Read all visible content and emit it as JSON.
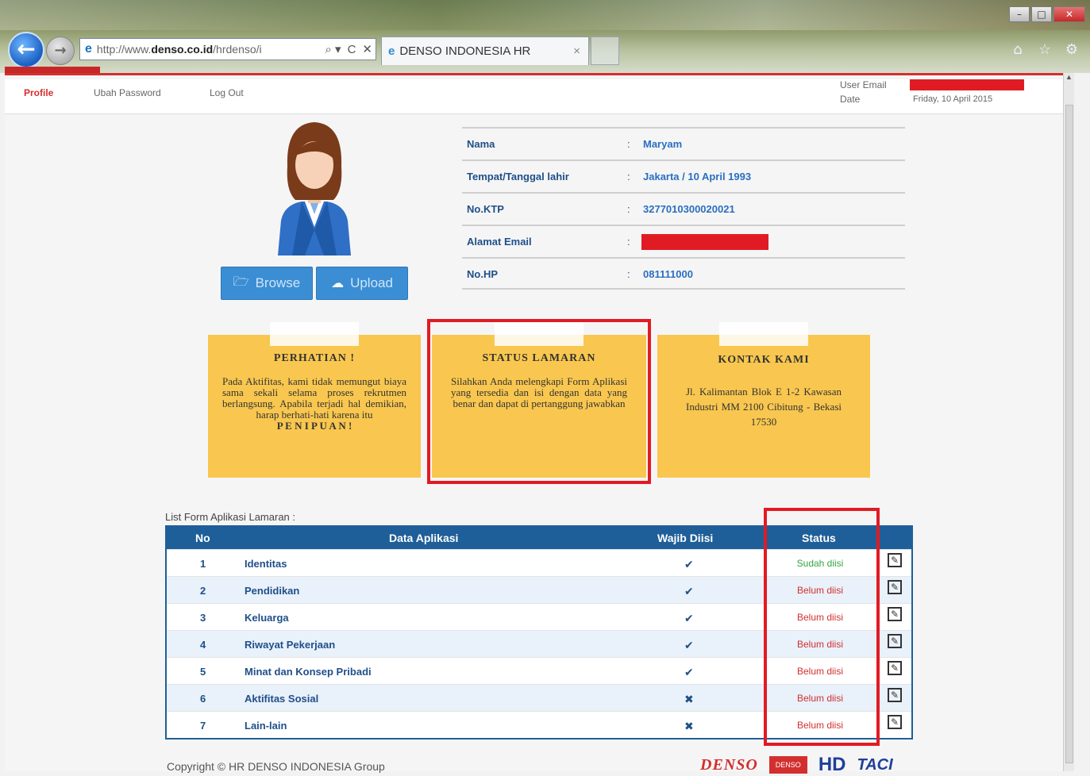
{
  "browser": {
    "url": "http://www.denso.co.id/hrdenso/i",
    "url_parts": {
      "prefix": "http://www.",
      "host": "denso.co.id",
      "path": "/hrdenso/i"
    },
    "tab_title": "DENSO INDONESIA HR",
    "tab_close": "×",
    "address_controls": [
      "⌕ ▾",
      "C",
      "✕"
    ],
    "window_buttons": {
      "minimize": "–",
      "maximize": "□",
      "close": "✕"
    },
    "tool_icons": [
      "home-icon",
      "star-icon",
      "gear-icon"
    ]
  },
  "topnav": {
    "items": [
      "Profile",
      "Ubah Password",
      "Log Out"
    ],
    "user_email_label": "User Email",
    "date_label": "Date",
    "date_value": "Friday, 10 April 2015"
  },
  "profile": {
    "fields": [
      {
        "label": "Nama",
        "value": "Maryam"
      },
      {
        "label": "Tempat/Tanggal lahir",
        "value": "Jakarta / 10 April 1993"
      },
      {
        "label": "No.KTP",
        "value": "3277010300020021"
      },
      {
        "label": "Alamat Email",
        "value": ""
      },
      {
        "label": "No.HP",
        "value": "081111000"
      }
    ],
    "colon": ":",
    "browse_label": "Browse",
    "upload_label": "Upload"
  },
  "notes": {
    "perhatian": {
      "title": "PERHATIAN !",
      "body": "Pada Aktifitas, kami tidak memungut biaya sama sekali selama proses rekrutmen berlangsung. Apabila terjadi hal demikian, harap berhati-hati karena itu",
      "emphasis": "P E N I P U A N !"
    },
    "status": {
      "title": "STATUS LAMARAN",
      "body": "Silahkan Anda melengkapi Form Aplikasi yang tersedia dan isi dengan data yang benar dan dapat di pertanggung jawabkan"
    },
    "kontak": {
      "title": "KONTAK KAMI",
      "body": "Jl. Kalimantan Blok E 1-2 Kawasan Industri MM 2100 Cibitung - Bekasi 17530"
    }
  },
  "list": {
    "title": "List Form Aplikasi Lamaran :",
    "headers": [
      "No",
      "Data Aplikasi",
      "Wajib Diisi",
      "Status"
    ],
    "rows": [
      {
        "no": "1",
        "name": "Identitas",
        "wajib": "✔",
        "status": "Sudah diisi",
        "done": true
      },
      {
        "no": "2",
        "name": "Pendidikan",
        "wajib": "✔",
        "status": "Belum diisi",
        "done": false
      },
      {
        "no": "3",
        "name": "Keluarga",
        "wajib": "✔",
        "status": "Belum diisi",
        "done": false
      },
      {
        "no": "4",
        "name": "Riwayat Pekerjaan",
        "wajib": "✔",
        "status": "Belum diisi",
        "done": false
      },
      {
        "no": "5",
        "name": "Minat dan Konsep Pribadi",
        "wajib": "✔",
        "status": "Belum diisi",
        "done": false
      },
      {
        "no": "6",
        "name": "Aktifitas Sosial",
        "wajib": "✖",
        "status": "Belum diisi",
        "done": false
      },
      {
        "no": "7",
        "name": "Lain-lain",
        "wajib": "✖",
        "status": "Belum diisi",
        "done": false
      }
    ],
    "edit_icon": "✎"
  },
  "footer": {
    "copyright": "Copyright © HR DENSO INDONESIA Group",
    "logos": [
      "DENSO",
      "DENSO",
      "HD",
      "TACI"
    ]
  },
  "colors": {
    "accent_red": "#d32f2f",
    "header_blue": "#1f5f99",
    "note_yellow": "#f9c74f",
    "button_blue": "#3b8ed4",
    "status_done": "#35a542"
  }
}
